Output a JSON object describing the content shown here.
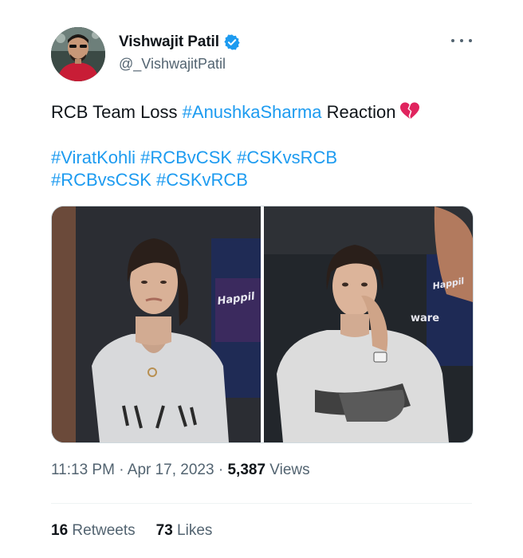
{
  "author": {
    "display_name": "Vishwajit Patil",
    "handle": "@_VishwajitPatil",
    "verified": true
  },
  "tweet": {
    "text_prefix": "RCB Team Loss ",
    "text_mention_tag": "#AnushkaSharma",
    "text_suffix": " Reaction",
    "emoji_icon": "broken-heart-icon",
    "hashtags_line1": [
      "#ViratKohli",
      "#RCBvCSK",
      "#CSKvsRCB"
    ],
    "hashtags_line2": [
      "#RCBvsCSK",
      "#CSKvRCB"
    ]
  },
  "media": {
    "image_count": 2,
    "left_image_text": "Happil",
    "right_image_texts": [
      "Happil",
      "ware"
    ]
  },
  "meta": {
    "time": "11:13 PM",
    "date": "Apr 17, 2023",
    "separator": "·",
    "views_count": "5,387",
    "views_label": "Views"
  },
  "stats": {
    "retweets_count": "16",
    "retweets_label": "Retweets",
    "likes_count": "73",
    "likes_label": "Likes"
  },
  "colors": {
    "accent": "#1d9bf0",
    "text_primary": "#0f1419",
    "text_secondary": "#536471",
    "broken_heart": "#e0245e"
  }
}
